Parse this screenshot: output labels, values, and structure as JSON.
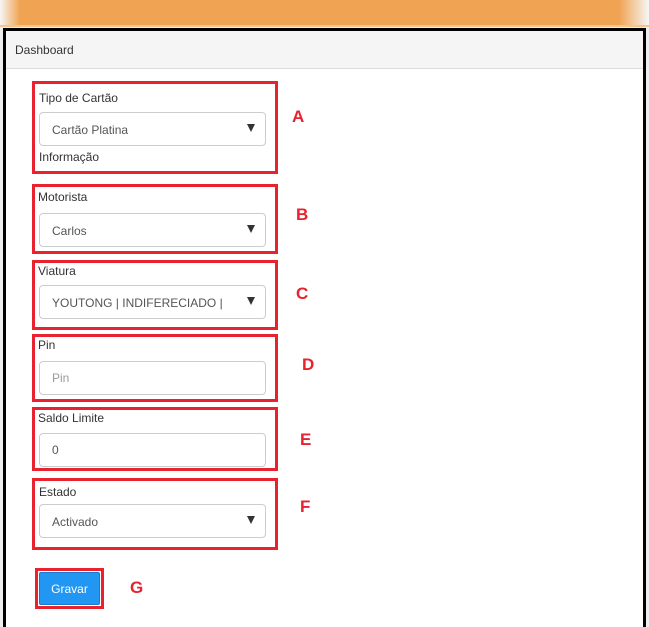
{
  "dashboard": {
    "title": "Dashboard"
  },
  "form": {
    "card_type": {
      "label": "Tipo de Cartão",
      "value": "Cartão Platina",
      "help": "Informação",
      "marker": "A"
    },
    "driver": {
      "label": "Motorista",
      "value": "Carlos",
      "marker": "B"
    },
    "vehicle": {
      "label": "Viatura",
      "value": "YOUTONG | INDIFERECIADO |",
      "marker": "C"
    },
    "pin": {
      "label": "Pin",
      "placeholder": "Pin",
      "marker": "D"
    },
    "limit_balance": {
      "label": "Saldo Limite",
      "value": "0",
      "marker": "E"
    },
    "status": {
      "label": "Estado",
      "value": "Activado",
      "marker": "F"
    },
    "save": {
      "label": "Gravar",
      "marker": "G"
    }
  },
  "colors": {
    "header_accent": "#f0a352",
    "annotation_red": "#e8222e",
    "primary_button": "#2196f3"
  },
  "icons": {
    "select_arrow": "chevron-down-icon"
  }
}
